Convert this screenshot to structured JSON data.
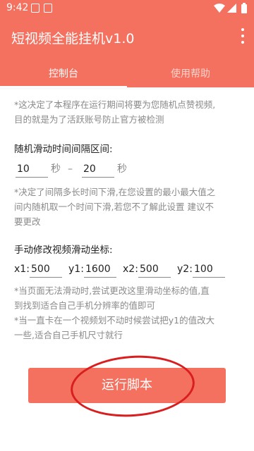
{
  "status_bar": {
    "time": "9:42",
    "left_icons": [
      "notification-icon",
      "a-icon"
    ],
    "right_icons": [
      "wifi-icon",
      "signal-icon",
      "battery-icon"
    ]
  },
  "app_bar": {
    "title": "短视频全能挂机v1.0",
    "menu_icon": "more-vert-icon"
  },
  "tabs": [
    {
      "label": "控制台",
      "active": true
    },
    {
      "label": "使用帮助",
      "active": false
    }
  ],
  "main": {
    "intro_note": "*这决定了本程序在运行期间将要为您随机点赞视频,\n目的就是为了活跃账号防止官方被检测",
    "interval": {
      "label": "随机滑动时间间隔区间:",
      "min_value": "10",
      "min_unit": "秒",
      "dash": "–",
      "max_value": "20",
      "max_unit": "秒",
      "note": "*决定了间隔多长时间下滑,在您设置的最小最大值之\n间内随机取一个时间下滑,若您不了解此设置 建议不\n要更改"
    },
    "coords": {
      "label": "手动修改视频滑动坐标:",
      "x1_label": "x1:",
      "x1_value": "500",
      "y1_label": "y1:",
      "y1_value": "1600",
      "x2_label": "x2:",
      "x2_value": "500",
      "y2_label": "y2:",
      "y2_value": "100",
      "note": "*当页面无法滑动时,尝试更改这里滑动坐标的值,直\n到找到适合自己手机分辨率的值即可\n*当一直卡在一个视频划不动时候尝试把y1的值改大\n一些,适合自己手机尺寸就行"
    },
    "run_button": "运行脚本"
  },
  "colors": {
    "accent": "#f4705f",
    "annotation": "#d81e1e"
  }
}
